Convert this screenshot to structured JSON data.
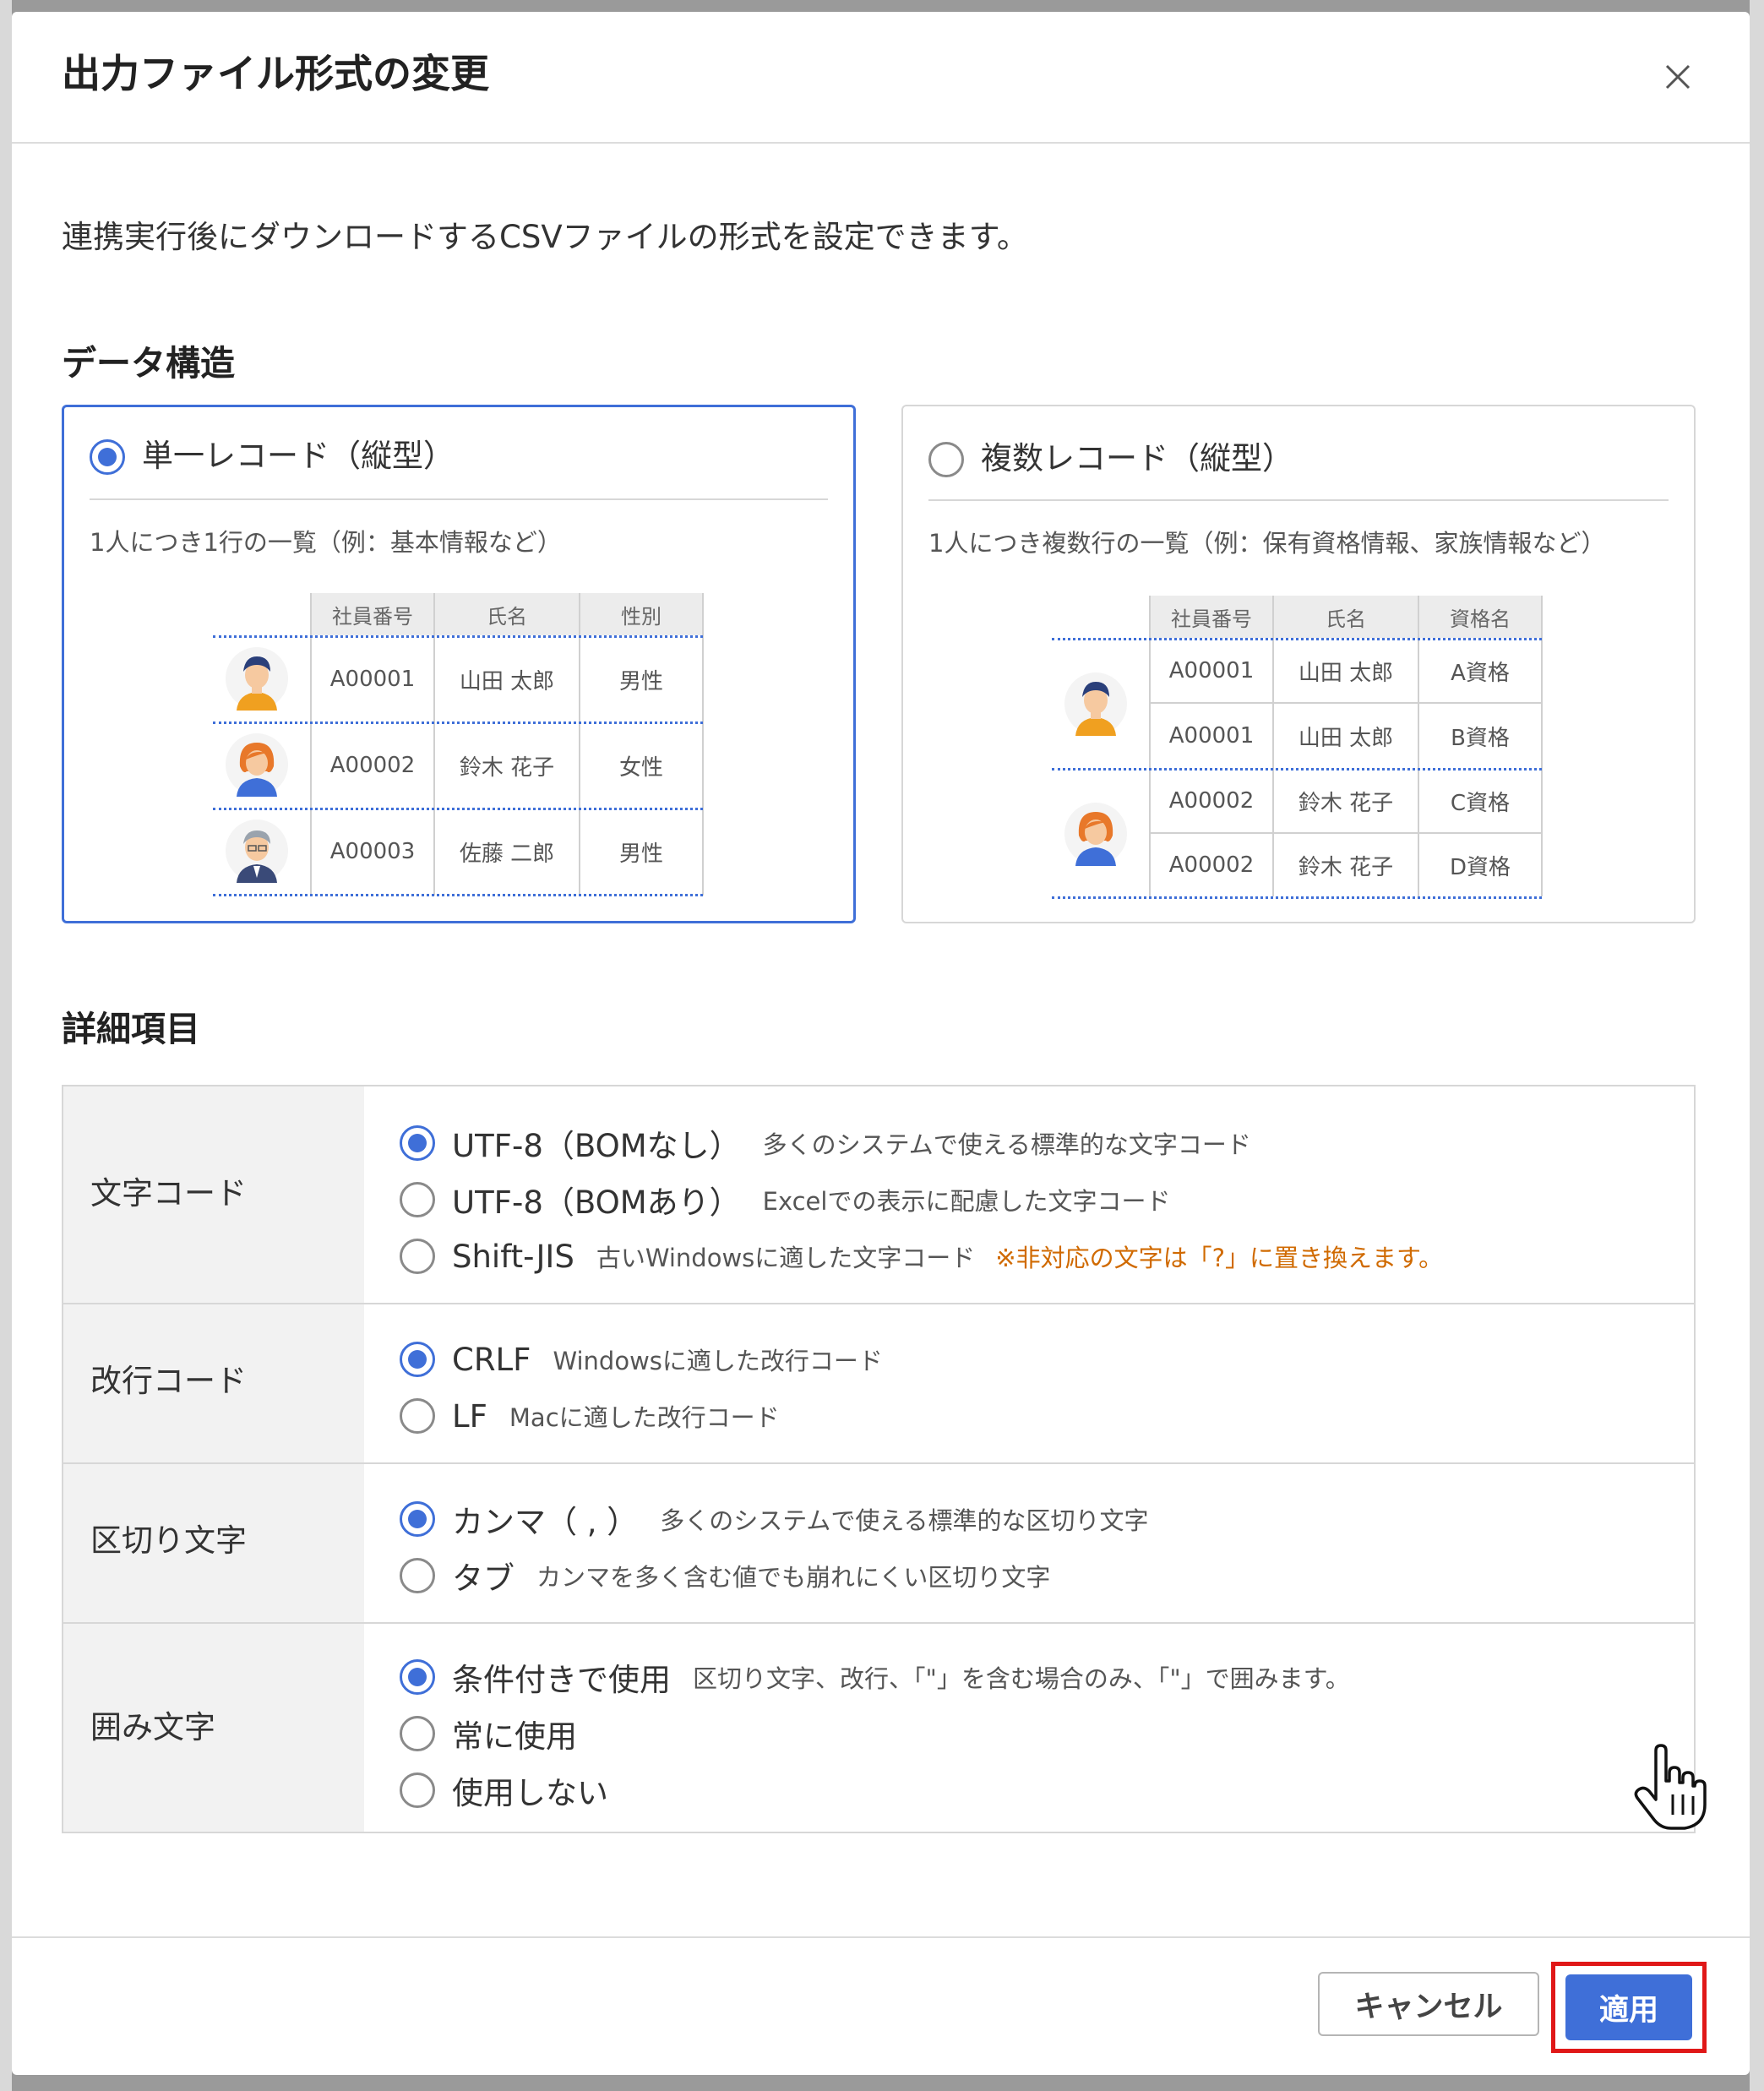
{
  "dialog": {
    "title": "出力ファイル形式の変更",
    "description": "連携実行後にダウンロードするCSVファイルの形式を設定できます。"
  },
  "data_structure": {
    "heading": "データ構造",
    "single": {
      "label": "単一レコード（縦型）",
      "selected": true,
      "subtitle": "1人につき1行の一覧（例：基本情報など）",
      "headers": [
        "社員番号",
        "氏名",
        "性別"
      ],
      "rows": [
        [
          "A00001",
          "山田 太郎",
          "男性"
        ],
        [
          "A00002",
          "鈴木 花子",
          "女性"
        ],
        [
          "A00003",
          "佐藤 二郎",
          "男性"
        ]
      ]
    },
    "multiple": {
      "label": "複数レコード（縦型）",
      "selected": false,
      "subtitle": "1人につき複数行の一覧（例：保有資格情報、家族情報など）",
      "headers": [
        "社員番号",
        "氏名",
        "資格名"
      ],
      "rows": [
        [
          "A00001",
          "山田 太郎",
          "A資格"
        ],
        [
          "A00001",
          "山田 太郎",
          "B資格"
        ],
        [
          "A00002",
          "鈴木 花子",
          "C資格"
        ],
        [
          "A00002",
          "鈴木 花子",
          "D資格"
        ]
      ]
    }
  },
  "details": {
    "heading": "詳細項目",
    "char_code": {
      "label": "文字コード",
      "options": [
        {
          "main": "UTF-8（BOMなし）",
          "sub": "多くのシステムで使える標準的な文字コード",
          "selected": true
        },
        {
          "main": "UTF-8（BOMあり）",
          "sub": "Excelでの表示に配慮した文字コード",
          "selected": false
        },
        {
          "main": "Shift-JIS",
          "sub": "古いWindowsに適した文字コード",
          "warn": "※非対応の文字は「?」に置き換えます。",
          "selected": false
        }
      ]
    },
    "line_code": {
      "label": "改行コード",
      "options": [
        {
          "main": "CRLF",
          "sub": "Windowsに適した改行コード",
          "selected": true
        },
        {
          "main": "LF",
          "sub": "Macに適した改行コード",
          "selected": false
        }
      ]
    },
    "delimiter": {
      "label": "区切り文字",
      "options": [
        {
          "main": "カンマ（ , ）",
          "sub": "多くのシステムで使える標準的な区切り文字",
          "selected": true
        },
        {
          "main": "タブ",
          "sub": "カンマを多く含む値でも崩れにくい区切り文字",
          "selected": false
        }
      ]
    },
    "quote": {
      "label": "囲み文字",
      "options": [
        {
          "main": "条件付きで使用",
          "sub": "区切り文字、改行、「\"」を含む場合のみ、「\"」で囲みます。",
          "selected": true
        },
        {
          "main": "常に使用",
          "sub": "",
          "selected": false
        },
        {
          "main": "使用しない",
          "sub": "",
          "selected": false
        }
      ]
    }
  },
  "footer": {
    "cancel_label": "キャンセル",
    "apply_label": "適用"
  },
  "colors": {
    "accent": "#3f6fd8",
    "warning": "#d06a00",
    "highlight": "#e01818"
  }
}
